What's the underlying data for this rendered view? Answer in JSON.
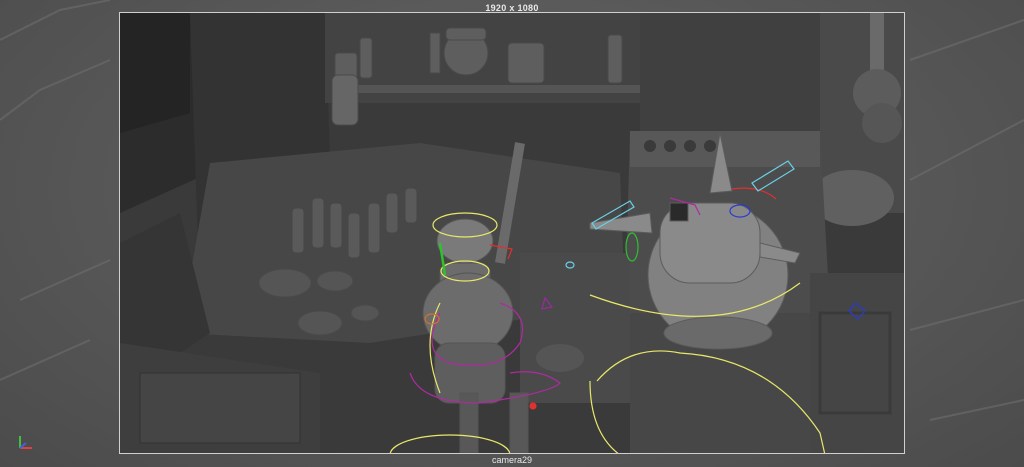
{
  "viewport": {
    "resolution_gate_label": "1920 x 1080",
    "camera_label": "camera29",
    "axis_gizmo_icon": "xyz-axis-icon",
    "colors": {
      "gate_border": "#d0d0d0",
      "controller_yellow": "#e8e86a",
      "controller_magenta": "#b02aa0",
      "controller_red": "#e03030",
      "controller_green": "#30c030",
      "controller_blue": "#2a3ad0",
      "controller_cyan": "#6ad0e8"
    }
  }
}
